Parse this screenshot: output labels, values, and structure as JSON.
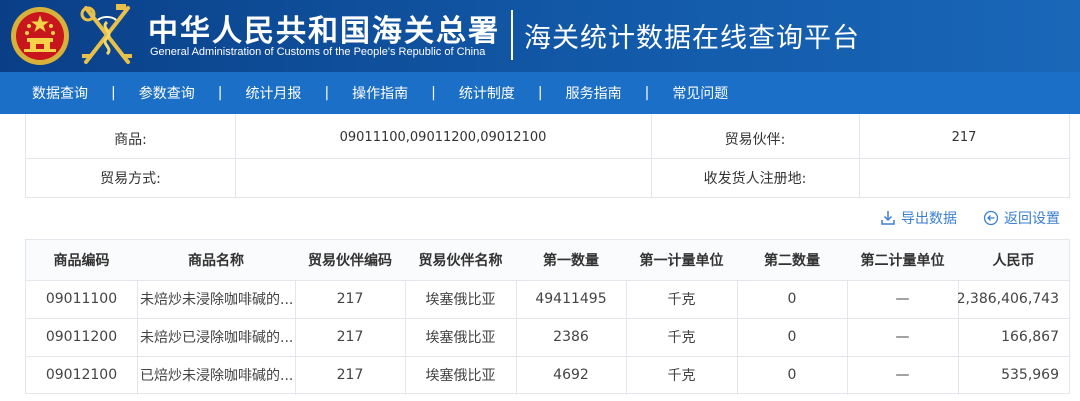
{
  "header": {
    "title_zh": "中华人民共和国海关总署",
    "title_en": "General Administration of Customs of the People's Republic of China",
    "platform_title": "海关统计数据在线查询平台"
  },
  "nav": {
    "items": [
      "数据查询",
      "参数查询",
      "统计月报",
      "操作指南",
      "统计制度",
      "服务指南",
      "常见问题"
    ],
    "separator": "|"
  },
  "params": {
    "commodity_label": "商品:",
    "commodity_value": "09011100,09011200,09012100",
    "partner_label": "贸易伙伴:",
    "partner_value": "217",
    "trade_mode_label": "贸易方式:",
    "trade_mode_value": "",
    "consignee_label": "收发货人注册地:",
    "consignee_value": ""
  },
  "actions": {
    "export_label": "导出数据",
    "export_icon": "download-icon",
    "reset_label": "返回设置",
    "reset_icon": "back-arrow-circle-icon",
    "link_color": "#3b7fd0"
  },
  "table": {
    "headers": [
      "商品编码",
      "商品名称",
      "贸易伙伴编码",
      "贸易伙伴名称",
      "第一数量",
      "第一计量单位",
      "第二数量",
      "第二计量单位",
      "人民币"
    ],
    "rows": [
      [
        "09011100",
        "未焙炒未浸除咖啡碱的...",
        "217",
        "埃塞俄比亚",
        "49411495",
        "千克",
        "0",
        "—",
        "2,386,406,743"
      ],
      [
        "09011200",
        "未焙炒已浸除咖啡碱的...",
        "217",
        "埃塞俄比亚",
        "2386",
        "千克",
        "0",
        "—",
        "166,867"
      ],
      [
        "09012100",
        "已焙炒未浸除咖啡碱的...",
        "217",
        "埃塞俄比亚",
        "4692",
        "千克",
        "0",
        "—",
        "535,969"
      ]
    ]
  },
  "colors": {
    "header_bg": "#0f4c97",
    "nav_bg": "#1b6fc6",
    "border": "#e3e6ea"
  }
}
